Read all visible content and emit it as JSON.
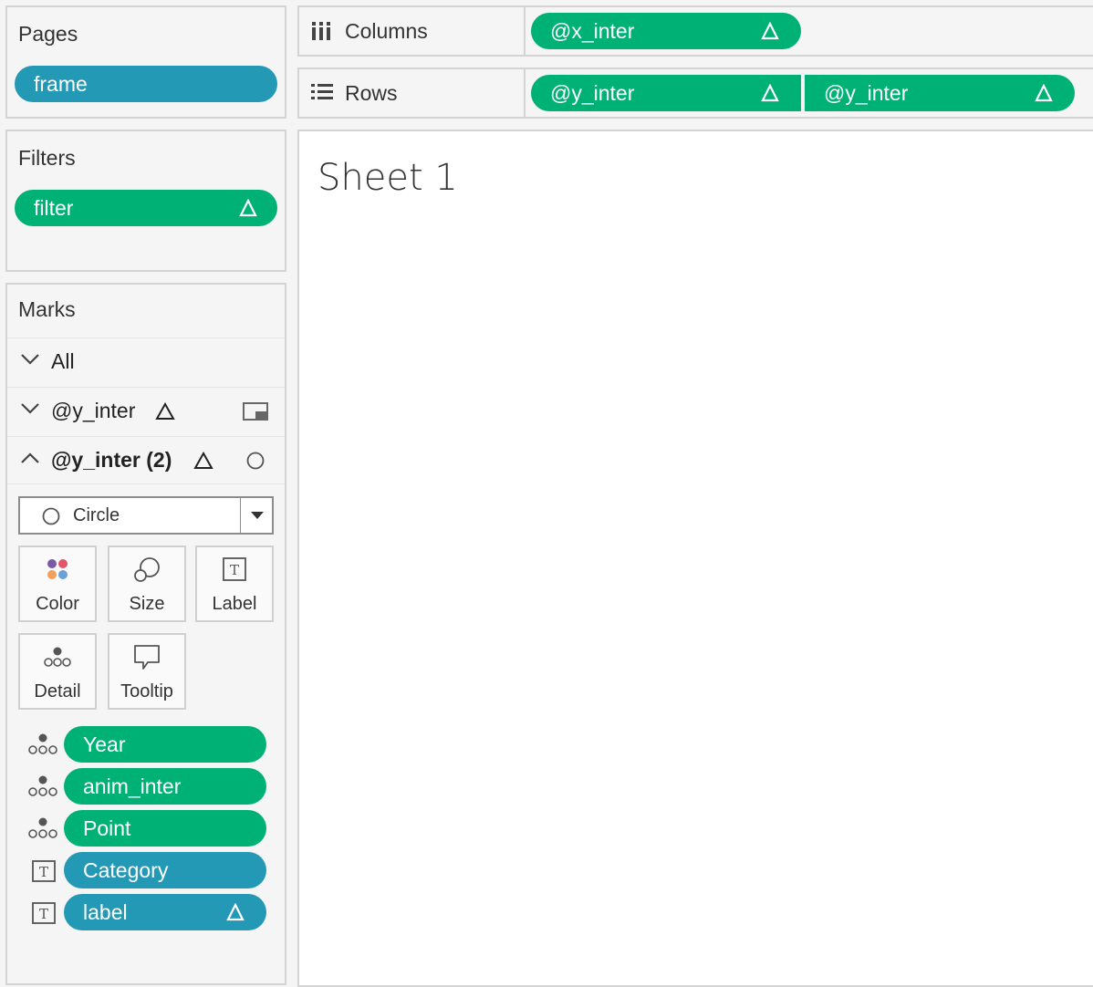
{
  "pages": {
    "title": "Pages",
    "pill": "frame"
  },
  "filters": {
    "title": "Filters",
    "pill": "filter"
  },
  "marks": {
    "title": "Marks",
    "rows": [
      "All",
      "@y_inter",
      "@y_inter (2)"
    ],
    "mark_type": "Circle",
    "cards": [
      "Color",
      "Size",
      "Label",
      "Detail",
      "Tooltip"
    ],
    "fields": [
      "Year",
      "anim_inter",
      "Point",
      "Category",
      "label"
    ]
  },
  "columns": {
    "label": "Columns",
    "pills": [
      "@x_inter"
    ]
  },
  "rows": {
    "label": "Rows",
    "pills": [
      "@y_inter",
      "@y_inter"
    ]
  },
  "sheet": {
    "title": "Sheet 1"
  },
  "colors": {
    "green": "#00b176",
    "blue": "#2399b5",
    "accent_purple": "#7b5aa6"
  }
}
